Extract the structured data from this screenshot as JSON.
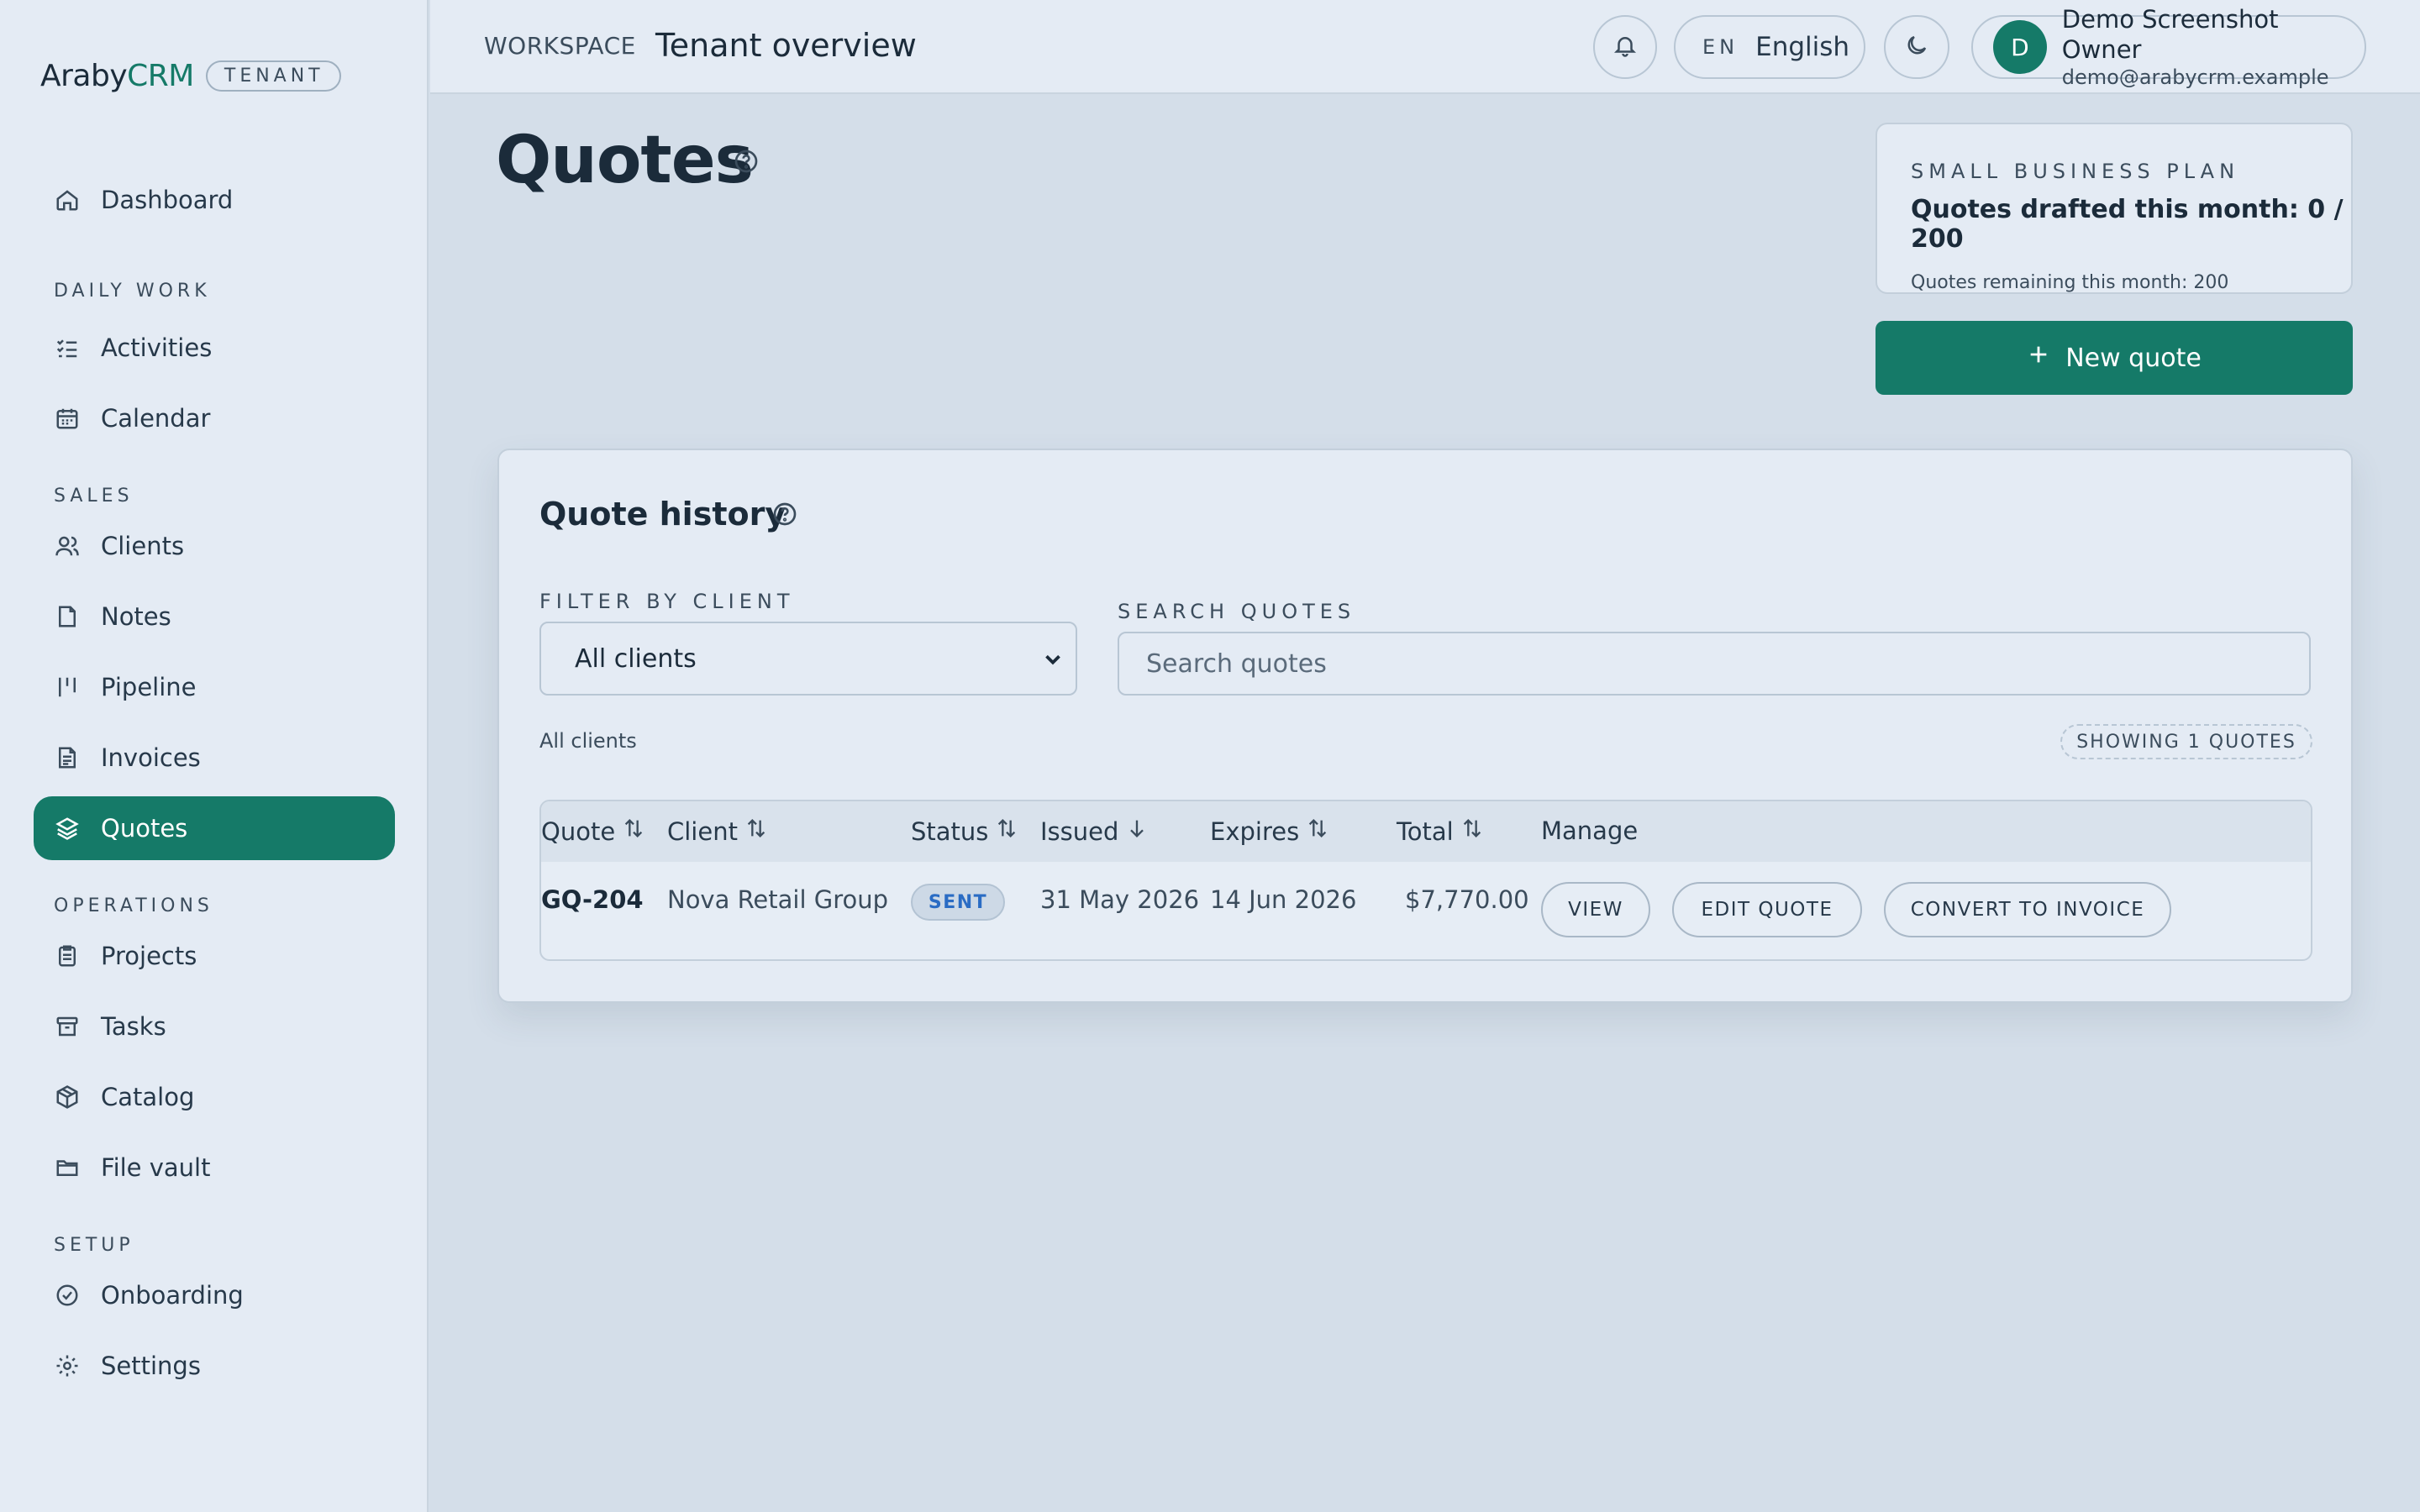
{
  "brand": {
    "name_part1": "Araby",
    "name_part2": "CRM",
    "tag": "TENANT"
  },
  "sidebar": {
    "items": [
      {
        "label": "Dashboard",
        "icon": "home-icon"
      },
      {
        "section": "DAILY WORK"
      },
      {
        "label": "Activities",
        "icon": "list-check-icon"
      },
      {
        "label": "Calendar",
        "icon": "calendar-icon"
      },
      {
        "section": "SALES"
      },
      {
        "label": "Clients",
        "icon": "users-icon"
      },
      {
        "label": "Notes",
        "icon": "note-icon"
      },
      {
        "label": "Pipeline",
        "icon": "pipeline-icon"
      },
      {
        "label": "Invoices",
        "icon": "invoice-icon"
      },
      {
        "label": "Quotes",
        "icon": "layers-icon",
        "active": true
      },
      {
        "section": "OPERATIONS"
      },
      {
        "label": "Projects",
        "icon": "clipboard-icon"
      },
      {
        "label": "Tasks",
        "icon": "archive-icon"
      },
      {
        "label": "Catalog",
        "icon": "package-icon"
      },
      {
        "label": "File vault",
        "icon": "folder-icon"
      },
      {
        "section": "SETUP"
      },
      {
        "label": "Onboarding",
        "icon": "check-circle-icon"
      },
      {
        "label": "Settings",
        "icon": "gear-icon"
      }
    ]
  },
  "header": {
    "workspace_label": "WORKSPACE",
    "title": "Tenant overview",
    "language": {
      "code": "EN",
      "name": "English"
    },
    "user": {
      "initial": "D",
      "name": "Demo Screenshot Owner",
      "email": "demo@arabycrm.example"
    }
  },
  "main": {
    "page_title": "Quotes",
    "plan": {
      "name": "SMALL BUSINESS PLAN",
      "usage": "Quotes drafted this month: 0 / 200",
      "remaining": "Quotes remaining this month: 200"
    },
    "new_quote_label": "New quote",
    "history": {
      "title": "Quote history",
      "filter_label": "FILTER BY CLIENT",
      "filter_value": "All clients",
      "search_label": "SEARCH QUOTES",
      "search_placeholder": "Search quotes",
      "filter_summary": "All clients",
      "count_badge": "SHOWING 1 QUOTES",
      "columns": [
        "Quote",
        "Client",
        "Status",
        "Issued",
        "Expires",
        "Total",
        "Manage"
      ],
      "rows": [
        {
          "quote": "GQ-204",
          "client": "Nova Retail Group",
          "status": "SENT",
          "issued": "31 May 2026",
          "expires": "14 Jun 2026",
          "total": "$7,770.00",
          "actions": [
            "VIEW",
            "EDIT QUOTE",
            "CONVERT TO INVOICE"
          ]
        }
      ]
    }
  },
  "colors": {
    "accent": "#157a68",
    "status_sent": "#2a6cc4",
    "background": "#d4dee9",
    "surface": "#e4ebf4"
  }
}
